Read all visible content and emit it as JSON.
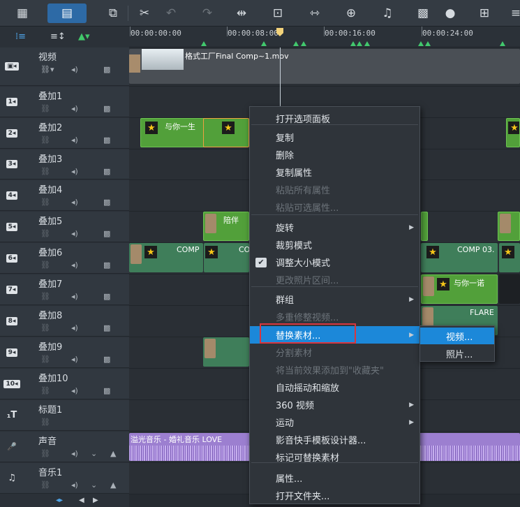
{
  "ruler": {
    "ticks": [
      "00:00:00:00",
      "00:00:08:00",
      "00:00:16:00",
      "00:00:24:00"
    ]
  },
  "tracks": [
    {
      "name": "视频",
      "id": "video"
    },
    {
      "name": "叠加1",
      "id": "1"
    },
    {
      "name": "叠加2",
      "id": "2"
    },
    {
      "name": "叠加3",
      "id": "3"
    },
    {
      "name": "叠加4",
      "id": "4"
    },
    {
      "name": "叠加5",
      "id": "5"
    },
    {
      "name": "叠加6",
      "id": "6"
    },
    {
      "name": "叠加7",
      "id": "7"
    },
    {
      "name": "叠加8",
      "id": "8"
    },
    {
      "name": "叠加9",
      "id": "9"
    },
    {
      "name": "叠加10",
      "id": "10"
    },
    {
      "name": "标题1",
      "id": "T"
    },
    {
      "name": "声音",
      "id": "voice"
    },
    {
      "name": "音乐1",
      "id": "music"
    }
  ],
  "clips": {
    "video_main": "格式工厂Final Comp~1.mov",
    "overlay2_a": "与你一生",
    "overlay5_a": "陪伴",
    "overlay6_a": "COMP",
    "overlay6_b": "CO",
    "overlay6_c": "COMP 03.",
    "overlay7_a": "与你一诺",
    "overlay8_a": "FLARE",
    "audio_main": "溢光音乐 - 婚礼音乐 LOVE"
  },
  "context_menu": {
    "items": [
      {
        "label": "打开选项面板",
        "disabled": false
      },
      {
        "label": "复制",
        "disabled": false
      },
      {
        "label": "删除",
        "disabled": false
      },
      {
        "label": "复制属性",
        "disabled": false
      },
      {
        "label": "粘贴所有属性",
        "disabled": true
      },
      {
        "label": "粘贴可选属性...",
        "disabled": true
      },
      {
        "label": "旋转",
        "disabled": false
      },
      {
        "label": "裁剪模式",
        "disabled": false
      },
      {
        "label": "调整大小模式",
        "disabled": false
      },
      {
        "label": "更改照片区间...",
        "disabled": true
      },
      {
        "label": "群组",
        "disabled": false
      },
      {
        "label": "多重修整视频...",
        "disabled": true
      },
      {
        "label": "替换素材...",
        "disabled": false
      },
      {
        "label": "分割素材",
        "disabled": true
      },
      {
        "label": "将当前效果添加到\"收藏夹\"",
        "disabled": true
      },
      {
        "label": "自动摇动和缩放",
        "disabled": false
      },
      {
        "label": "360 视频",
        "disabled": false
      },
      {
        "label": "运动",
        "disabled": false
      },
      {
        "label": "影音快手模板设计器...",
        "disabled": false
      },
      {
        "label": "标记可替换素材",
        "disabled": false
      },
      {
        "label": "属性...",
        "disabled": false
      },
      {
        "label": "打开文件夹...",
        "disabled": false
      }
    ]
  },
  "submenu": {
    "items": [
      "视频...",
      "照片..."
    ]
  },
  "colors": {
    "highlight": "#1c88d9",
    "red_box": "#d9363e",
    "clip_green": "#52a03a",
    "audio_purple": "#9c7fd0"
  }
}
